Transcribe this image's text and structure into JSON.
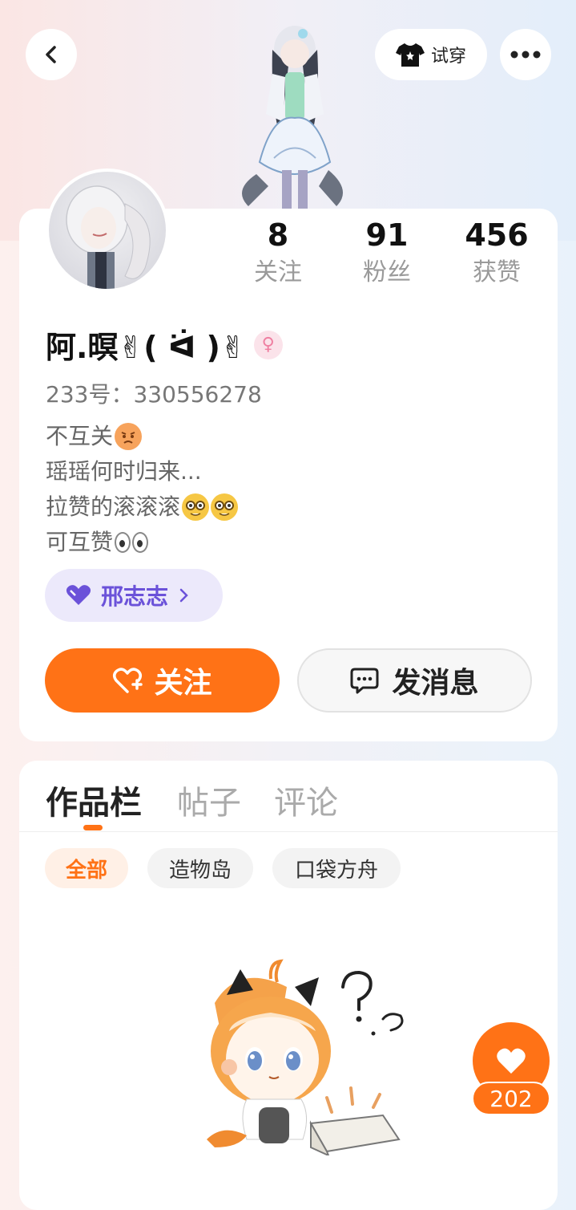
{
  "header": {
    "back_icon": "chevron-left-icon",
    "try_on_label": "试穿",
    "try_on_icon": "tshirt-icon",
    "more_icon": "more-dots-icon"
  },
  "profile": {
    "stats": [
      {
        "value": "8",
        "label": "关注"
      },
      {
        "value": "91",
        "label": "粉丝"
      },
      {
        "value": "456",
        "label": "获赞"
      }
    ],
    "nickname": "阿.暝✌( ᐛ )✌",
    "gender_icon": "female-icon",
    "uid": "233号：330556278",
    "bio": [
      "不互关",
      "瑶瑶何时归来...",
      "拉赞的滚滚滚",
      "可互赞"
    ],
    "tag_chip": "邢志志",
    "follow_label": "关注",
    "message_label": "发消息"
  },
  "tabs": [
    {
      "label": "作品栏",
      "active": true
    },
    {
      "label": "帖子",
      "active": false
    },
    {
      "label": "评论",
      "active": false
    }
  ],
  "filters": [
    {
      "label": "全部",
      "active": true
    },
    {
      "label": "造物岛",
      "active": false
    },
    {
      "label": "口袋方舟",
      "active": false
    }
  ],
  "like_button": {
    "count": "202"
  },
  "colors": {
    "accent": "#ff7216",
    "chip_purple": "#6b52d9"
  }
}
